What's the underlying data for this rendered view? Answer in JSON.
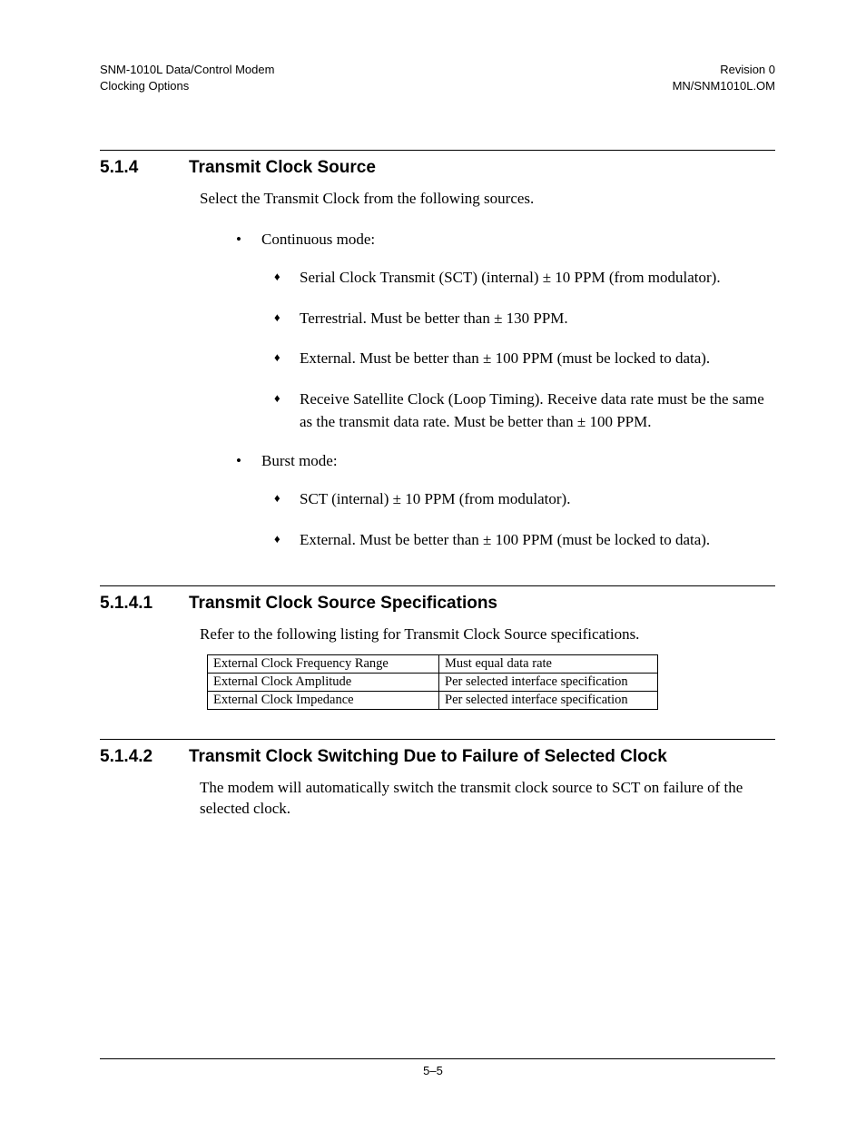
{
  "header": {
    "left_line1": "SNM-1010L Data/Control Modem",
    "left_line2": "Clocking Options",
    "right_line1": "Revision 0",
    "right_line2": "MN/SNM1010L.OM"
  },
  "s514": {
    "num": "5.1.4",
    "title": "Transmit Clock Source",
    "intro": "Select the Transmit Clock from the following sources.",
    "bullets": [
      {
        "label": "Continuous mode:",
        "items": [
          "Serial Clock Transmit (SCT) (internal) ± 10 PPM (from modulator).",
          "Terrestrial. Must be better than ± 130 PPM.",
          "External. Must be better than ± 100 PPM (must be locked to data).",
          "Receive Satellite Clock (Loop Timing). Receive data rate must be the same as the transmit data rate. Must be better than ± 100 PPM."
        ]
      },
      {
        "label": "Burst mode:",
        "items": [
          "SCT (internal) ± 10 PPM (from modulator).",
          "External. Must be better than ± 100 PPM (must be locked to data)."
        ]
      }
    ]
  },
  "s5141": {
    "num": "5.1.4.1",
    "title": "Transmit Clock Source Specifications",
    "intro": "Refer to the following listing for Transmit Clock Source specifications.",
    "table": [
      {
        "k": "External Clock Frequency Range",
        "v": "Must equal data rate"
      },
      {
        "k": "External Clock Amplitude",
        "v": "Per selected interface specification"
      },
      {
        "k": "External Clock Impedance",
        "v": "Per selected interface specification"
      }
    ]
  },
  "s5142": {
    "num": "5.1.4.2",
    "title": "Transmit Clock Switching Due to Failure of Selected Clock",
    "intro": "The modem will automatically switch the transmit clock source to SCT on failure of the selected clock."
  },
  "footer": {
    "page": "5–5"
  }
}
